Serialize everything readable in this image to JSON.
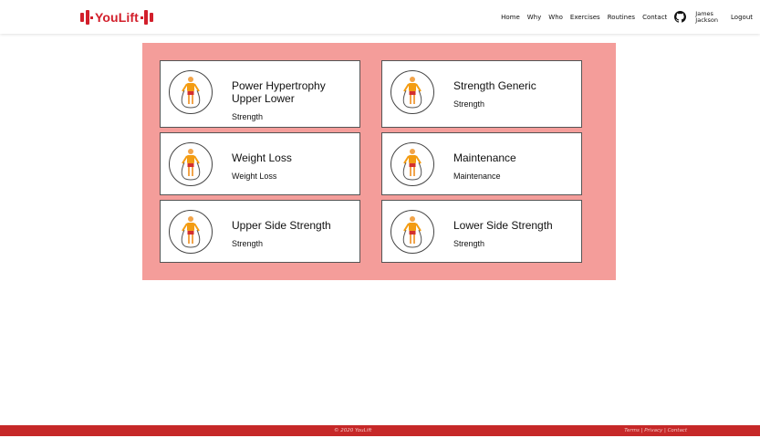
{
  "header": {
    "logo_text": "YouLift",
    "nav": [
      "Home",
      "Why",
      "Who",
      "Exercises",
      "Routines",
      "Contact"
    ],
    "user_first": "James",
    "user_last": "Jackson",
    "logout": "Logout"
  },
  "routines": [
    {
      "title": "Power Hypertrophy Upper Lower",
      "category": "Strength"
    },
    {
      "title": "Strength Generic",
      "category": "Strength"
    },
    {
      "title": "Weight Loss",
      "category": "Weight Loss"
    },
    {
      "title": "Maintenance",
      "category": "Maintenance"
    },
    {
      "title": "Upper Side Strength",
      "category": "Strength"
    },
    {
      "title": "Lower Side Strength",
      "category": "Strength"
    }
  ],
  "footer": {
    "copyright": "© 2020 YouLift",
    "terms": "Terms",
    "privacy": "Privacy",
    "contact": "Contact",
    "sep": " | "
  },
  "colors": {
    "brand": "#d21f2b",
    "panel": "#f49d9a",
    "footer": "#c62828"
  }
}
